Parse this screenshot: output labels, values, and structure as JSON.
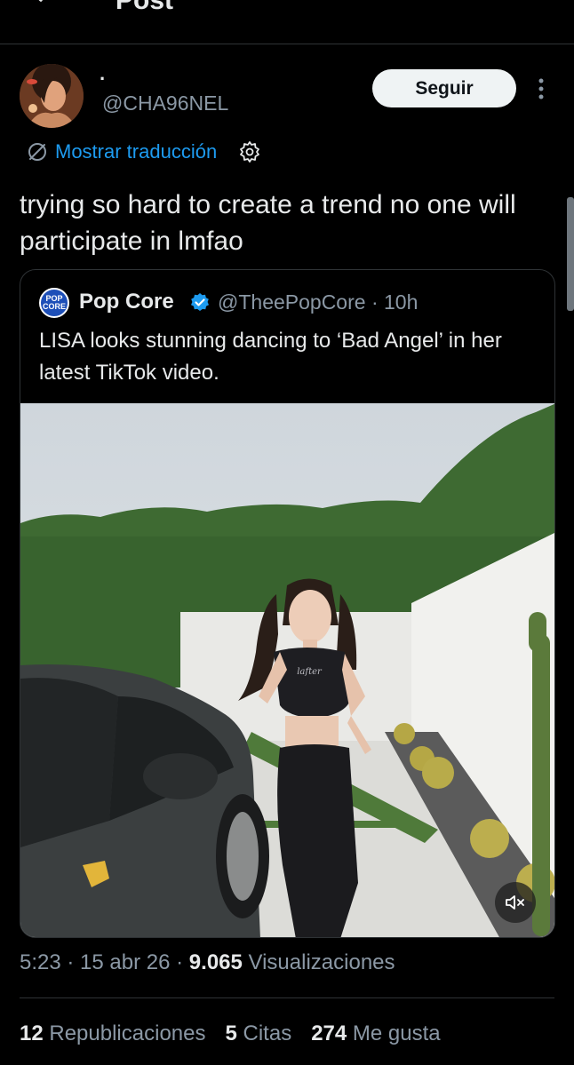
{
  "header": {
    "title": "Post"
  },
  "author": {
    "display_name": "·",
    "handle": "@CHA96NEL",
    "follow_label": "Seguir"
  },
  "translate": {
    "label": "Mostrar traducción"
  },
  "tweet": {
    "text": "trying so hard to create a trend no one will participate in lmfao"
  },
  "quote": {
    "avatar_text": "POP CORE",
    "name": "Pop Core",
    "handle_time": "@TheePopCore · 10h",
    "text": "LISA looks stunning dancing to ‘Bad Angel’ in her latest TikTok video.",
    "shirt_text": "lafter"
  },
  "meta": {
    "time": "5:23",
    "sep1": " · ",
    "date": "15 abr 26",
    "sep2": " · ",
    "views": "9.065",
    "views_label": " Visualizaciones"
  },
  "stats": {
    "reposts": "12",
    "reposts_label": " Republicaciones",
    "quotes": "5",
    "quotes_label": " Citas",
    "likes": "274",
    "likes_label": " Me gusta"
  },
  "colors": {
    "accent": "#1d9bf0",
    "background": "#000000",
    "muted": "#8b98a5"
  },
  "icons": [
    "back-arrow-icon",
    "more-vertical-icon",
    "translate-icon",
    "gear-icon",
    "verified-icon",
    "mute-icon"
  ]
}
